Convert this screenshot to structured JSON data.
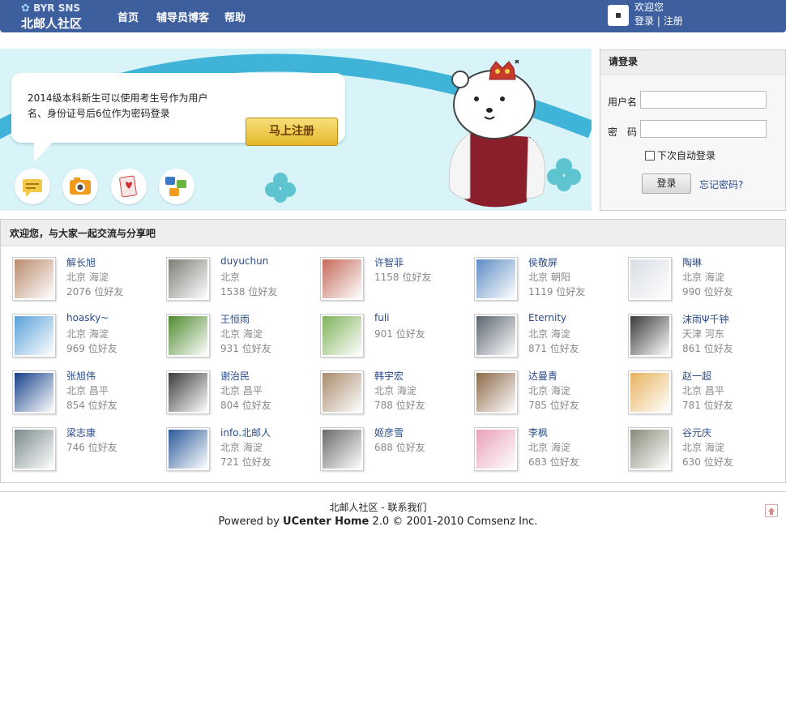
{
  "header": {
    "logo_top": "BYR SNS",
    "logo_bottom": "北邮人社区",
    "nav": [
      "首页",
      "辅导员博客",
      "帮助"
    ],
    "welcome": "欢迎您",
    "login_link": "登录",
    "separator": "|",
    "register_link": "注册"
  },
  "banner": {
    "text": "2014级本科新生可以使用考生号作为用户名、身份证号后6位作为密码登录",
    "register_button": "马上注册",
    "icons": [
      "comment-icon",
      "camera-icon",
      "cards-icon",
      "share-icon"
    ]
  },
  "login": {
    "title": "请登录",
    "username_label": "用户名",
    "username_value": "",
    "password_label": "密　码",
    "password_value": "",
    "remember_label": "下次自动登录",
    "remember_checked": false,
    "login_button": "登录",
    "forgot_link": "忘记密码?"
  },
  "friends": {
    "title": "欢迎您，与大家一起交流与分享吧",
    "rows": [
      [
        {
          "name": "解长旭",
          "loc": "北京 海淀",
          "count": "2076 位好友",
          "color": "#b98a6d"
        },
        {
          "name": "duyuchun",
          "loc": "北京",
          "count": "1538 位好友",
          "color": "#7d7d78"
        },
        {
          "name": "许智菲",
          "loc": "",
          "count": "1158 位好友",
          "color": "#c46a5a"
        },
        {
          "name": "侯敬屏",
          "loc": "北京 朝阳",
          "count": "1119 位好友",
          "color": "#5d8cc4"
        },
        {
          "name": "陶琳",
          "loc": "北京 海淀",
          "count": "990 位好友",
          "color": "#d9dde3"
        }
      ],
      [
        {
          "name": "hoasky~",
          "loc": "北京 海淀",
          "count": "969 位好友",
          "color": "#5aa0d8"
        },
        {
          "name": "王恒雨",
          "loc": "北京 海淀",
          "count": "931 位好友",
          "color": "#4f8a2f"
        },
        {
          "name": "fuli",
          "loc": "",
          "count": "901 位好友",
          "color": "#7fb25b"
        },
        {
          "name": "Eternity",
          "loc": "北京 海淀",
          "count": "871 位好友",
          "color": "#5a6470"
        },
        {
          "name": "沫雨Ψ千钟",
          "loc": "天津 河东",
          "count": "861 位好友",
          "color": "#3a3a3a"
        }
      ],
      [
        {
          "name": "张旭伟",
          "loc": "北京 昌平",
          "count": "854 位好友",
          "color": "#16408a"
        },
        {
          "name": "谢治民",
          "loc": "北京 昌平",
          "count": "804 位好友",
          "color": "#3c3c3c"
        },
        {
          "name": "韩宇宏",
          "loc": "北京 海淀",
          "count": "788 位好友",
          "color": "#a88a6c"
        },
        {
          "name": "达曼青",
          "loc": "北京 海淀",
          "count": "785 位好友",
          "color": "#8c6a4a"
        },
        {
          "name": "赵一超",
          "loc": "北京 昌平",
          "count": "781 位好友",
          "color": "#e7b25e"
        }
      ],
      [
        {
          "name": "梁志康",
          "loc": "",
          "count": "746 位好友",
          "color": "#7a8a8c"
        },
        {
          "name": "info.北邮人",
          "loc": "北京 海淀",
          "count": "721 位好友",
          "color": "#2a5a9a"
        },
        {
          "name": "姬彦雪",
          "loc": "",
          "count": "688 位好友",
          "color": "#6a6a6a"
        },
        {
          "name": "李枫",
          "loc": "北京 海淀",
          "count": "683 位好友",
          "color": "#e8a0b8"
        },
        {
          "name": "谷元庆",
          "loc": "北京 海淀",
          "count": "630 位好友",
          "color": "#8a8a7a"
        }
      ]
    ]
  },
  "footer": {
    "site": "北邮人社区",
    "dash": "-",
    "contact": "联系我们",
    "powered_prefix": "Powered by",
    "product": "UCenter Home",
    "powered_suffix": "2.0 © 2001-2010 Comsenz Inc."
  }
}
